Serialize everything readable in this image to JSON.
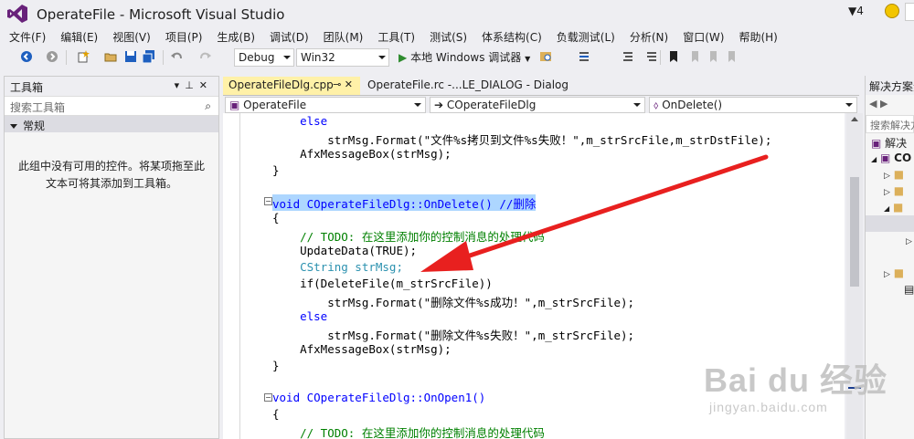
{
  "window": {
    "title": "OperateFile - Microsoft Visual Studio",
    "notification_count": "4"
  },
  "menu": [
    "文件(F)",
    "编辑(E)",
    "视图(V)",
    "项目(P)",
    "生成(B)",
    "调试(D)",
    "团队(M)",
    "工具(T)",
    "测试(S)",
    "体系结构(C)",
    "负载测试(L)",
    "分析(N)",
    "窗口(W)",
    "帮助(H)"
  ],
  "toolbar": {
    "config": "Debug",
    "platform": "Win32",
    "run_label": "本地 Windows 调试器"
  },
  "toolbox": {
    "title": "工具箱",
    "search_placeholder": "搜索工具箱",
    "section": "常规",
    "empty_message": "此组中没有可用的控件。将某项拖至此文本可将其添加到工具箱。"
  },
  "tabs": [
    {
      "label": "OperateFileDlg.cpp",
      "active": true
    },
    {
      "label": "OperateFile.rc -...LE_DIALOG - Dialog",
      "active": false
    }
  ],
  "navbar": {
    "project": "OperateFile",
    "class": "COperateFileDlg",
    "member": "OnDelete()"
  },
  "code_lines": [
    "    else",
    "        strMsg.Format(\"文件%s拷贝到文件%s失败！\",m_strSrcFile,m_strDstFile);",
    "    AfxMessageBox(strMsg);",
    "}",
    "",
    "void COperateFileDlg::OnDelete() //删除",
    "{",
    "    // TODO: 在这里添加你的控制消息的处理代码",
    "    UpdateData(TRUE);",
    "    CString strMsg;",
    "    if(DeleteFile(m_strSrcFile))",
    "        strMsg.Format(\"删除文件%s成功！\",m_strSrcFile);",
    "    else",
    "        strMsg.Format(\"删除文件%s失败！\",m_strSrcFile);",
    "    AfxMessageBox(strMsg);",
    "}",
    "",
    "void COperateFileDlg::OnOpen1()",
    "{",
    "    // TODO: 在这里添加你的控制消息的处理代码"
  ],
  "solution_explorer": {
    "title": "解决方案资",
    "search_placeholder": "搜索解决方",
    "root": "解决",
    "project": "CO"
  },
  "watermark": {
    "main": "Bai du 经验",
    "sub": "jingyan.baidu.com"
  },
  "colors": {
    "tab_active": "#fff1a8",
    "keyword": "#0000ff",
    "comment": "#008000",
    "type": "#2b91af",
    "annotation_arrow": "#e8201f"
  }
}
